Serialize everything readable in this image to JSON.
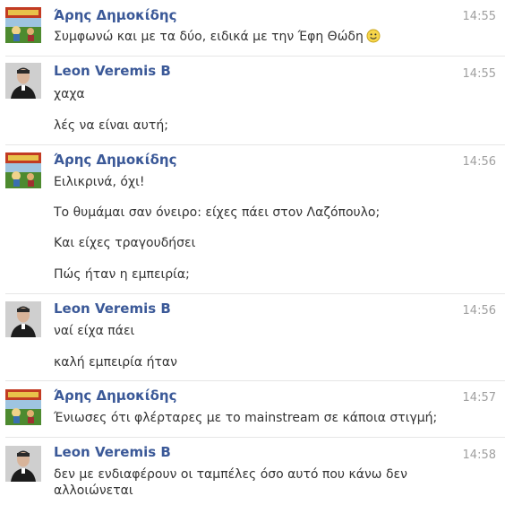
{
  "messages": [
    {
      "author": "Άρης Δημοκίδης",
      "time": "14:55",
      "avatar": "aris-avatar",
      "lines": [
        "Συμφωνώ και με τα δύο, ειδικά με την Έφη Θώδη"
      ],
      "emoji": "smiley-face-icon"
    },
    {
      "author": "Leon Veremis B",
      "time": "14:55",
      "avatar": "leon-avatar",
      "lines": [
        "χαχα",
        "λές να είναι αυτή;"
      ]
    },
    {
      "author": "Άρης Δημοκίδης",
      "time": "14:56",
      "avatar": "aris-avatar",
      "lines": [
        "Ειλικρινά, όχι!",
        "Το θυμάμαι σαν όνειρο: είχες πάει στον Λαζόπουλο;",
        "Και είχες τραγουδήσει",
        "Πώς ήταν η εμπειρία;"
      ]
    },
    {
      "author": "Leon Veremis B",
      "time": "14:56",
      "avatar": "leon-avatar",
      "lines": [
        "ναί είχα πάει",
        "καλή εμπειρία ήταν"
      ]
    },
    {
      "author": "Άρης Δημοκίδης",
      "time": "14:57",
      "avatar": "aris-avatar",
      "lines": [
        "Ένιωσες ότι φλέρταρες με το mainstream σε κάποια στιγμή;"
      ]
    },
    {
      "author": "Leon Veremis B",
      "time": "14:58",
      "avatar": "leon-avatar",
      "lines": [
        "δεν με ενδιαφέρουν οι ταμπέλες όσο αυτό που κάνω δεν αλλοιώνεται"
      ]
    }
  ],
  "colors": {
    "author": "#3b5998",
    "text": "#333333",
    "time": "#a0a0a0"
  }
}
